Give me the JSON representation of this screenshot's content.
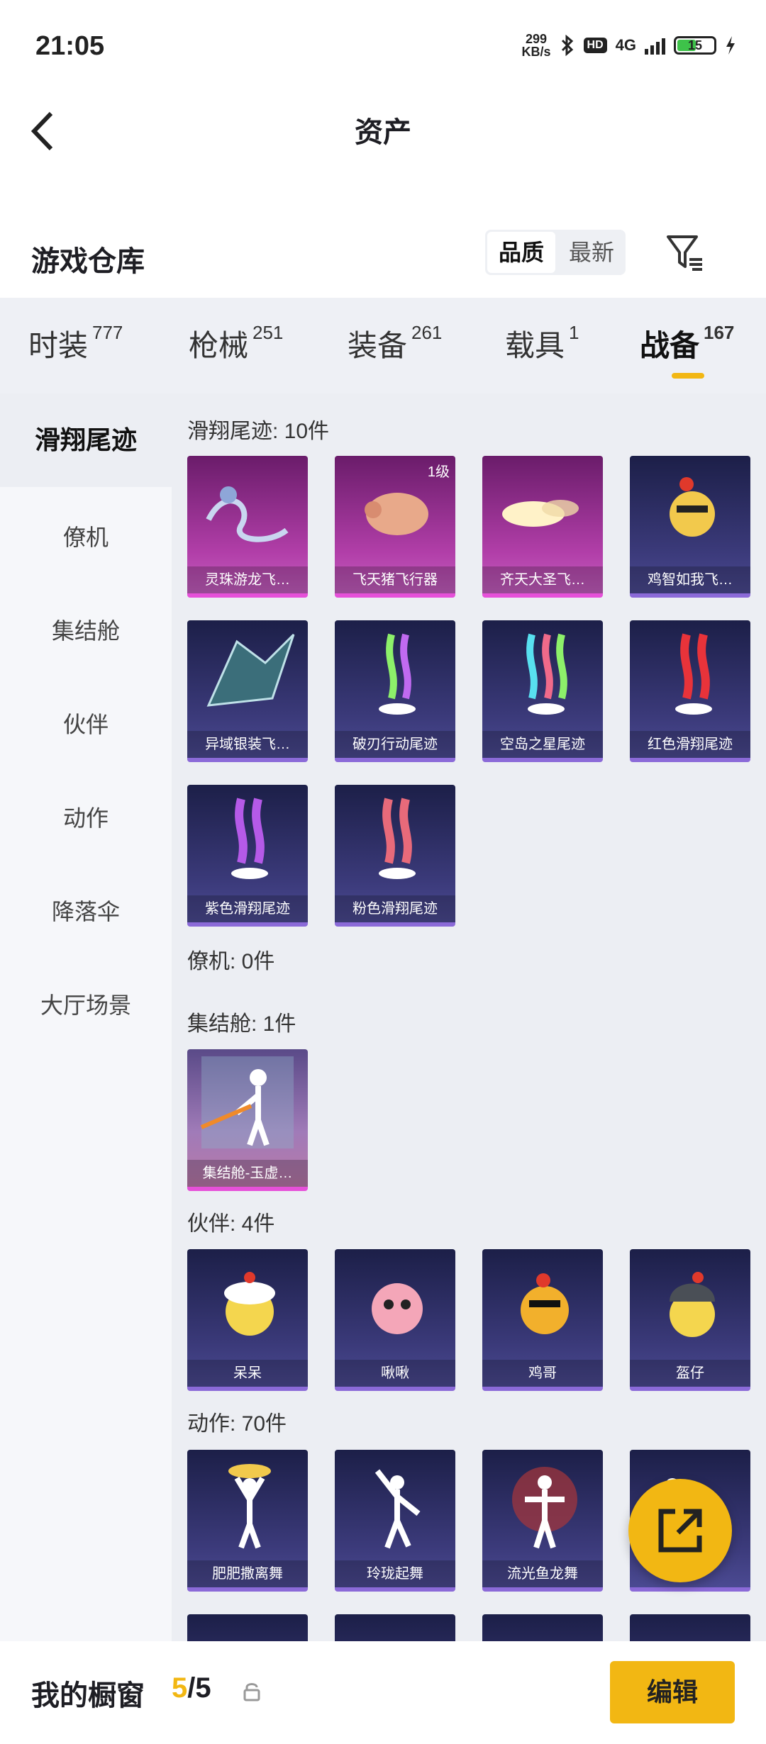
{
  "status": {
    "time": "21:05",
    "speed": "299",
    "speed_unit": "KB/s",
    "hd": "HD",
    "network": "4G",
    "battery": "15"
  },
  "header": {
    "title": "资产"
  },
  "warehouse": {
    "title": "游戏仓库",
    "sort_quality": "品质",
    "sort_latest": "最新"
  },
  "tabs": [
    {
      "label": "时装",
      "count": "777"
    },
    {
      "label": "枪械",
      "count": "251"
    },
    {
      "label": "装备",
      "count": "261"
    },
    {
      "label": "载具",
      "count": "1"
    },
    {
      "label": "战备",
      "count": "167"
    }
  ],
  "sidebar": [
    "滑翔尾迹",
    "僚机",
    "集结舱",
    "伙伴",
    "动作",
    "降落伞",
    "大厅场景"
  ],
  "sections": {
    "glide": {
      "title": "滑翔尾迹: 10件",
      "items": [
        "灵珠游龙飞…",
        "飞天猪飞行器",
        "齐天大圣飞…",
        "鸡智如我飞…",
        "异域银装飞…",
        "破刃行动尾迹",
        "空岛之星尾迹",
        "红色滑翔尾迹",
        "紫色滑翔尾迹",
        "粉色滑翔尾迹"
      ],
      "level_badge": "1级"
    },
    "wingman": {
      "title": "僚机: 0件"
    },
    "pod": {
      "title": "集结舱: 1件",
      "items": [
        "集结舱-玉虚…"
      ]
    },
    "partner": {
      "title": "伙伴: 4件",
      "items": [
        "呆呆",
        "啾啾",
        "鸡哥",
        "盔仔"
      ]
    },
    "emote": {
      "title": "动作: 70件",
      "items": [
        "肥肥撒离舞",
        "玲珑起舞",
        "流光鱼龙舞"
      ]
    }
  },
  "bottom": {
    "showcase_label": "我的橱窗",
    "count_current": "5",
    "count_sep": "/",
    "count_total": "5",
    "edit_label": "编辑"
  },
  "colors": {
    "accent": "#f2b713",
    "rare_pink": "#e650d9",
    "epic_purple": "#8b6ad8"
  },
  "icons": [
    "back-arrow-icon",
    "filter-icon",
    "lock-icon",
    "share-icon",
    "bluetooth-icon",
    "signal-icon",
    "battery-icon"
  ]
}
